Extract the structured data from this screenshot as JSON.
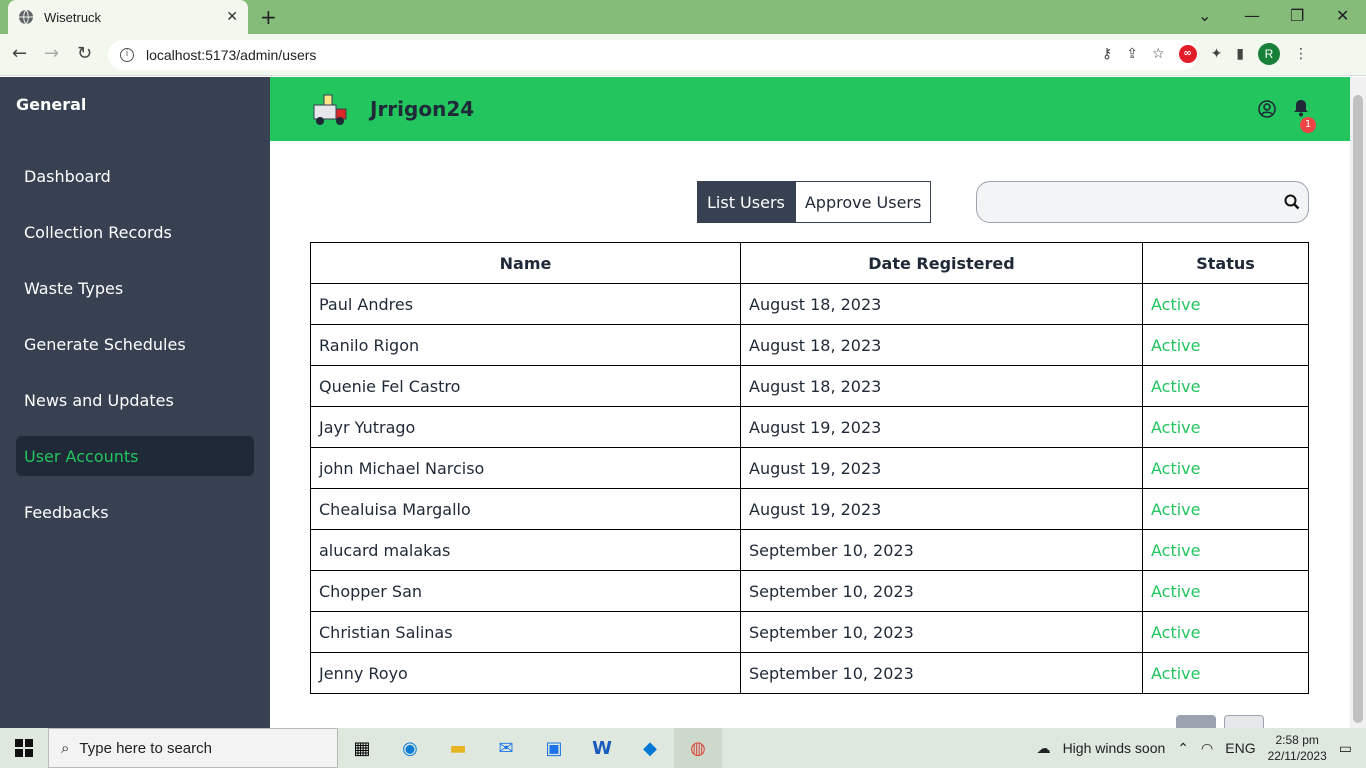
{
  "browser": {
    "tab_title": "Wisetruck",
    "url": "localhost:5173/admin/users",
    "profile_initial": "R"
  },
  "sidebar": {
    "heading": "General",
    "items": [
      {
        "label": "Dashboard"
      },
      {
        "label": "Collection Records"
      },
      {
        "label": "Waste Types"
      },
      {
        "label": "Generate Schedules"
      },
      {
        "label": "News and Updates"
      },
      {
        "label": "User Accounts"
      },
      {
        "label": "Feedbacks"
      }
    ],
    "active_item": "User Accounts"
  },
  "header": {
    "brand": "Jrrigon24",
    "notification_count": "1"
  },
  "tabs": {
    "list_users": "List Users",
    "approve_users": "Approve Users"
  },
  "search": {
    "value": ""
  },
  "table": {
    "columns": [
      "Name",
      "Date Registered",
      "Status"
    ],
    "rows": [
      {
        "name": "Paul Andres",
        "date": "August 18, 2023",
        "status": "Active"
      },
      {
        "name": "Ranilo Rigon",
        "date": "August 18, 2023",
        "status": "Active"
      },
      {
        "name": "Quenie Fel Castro",
        "date": "August 18, 2023",
        "status": "Active"
      },
      {
        "name": "Jayr Yutrago",
        "date": "August 19, 2023",
        "status": "Active"
      },
      {
        "name": "john Michael Narciso",
        "date": "August 19, 2023",
        "status": "Active"
      },
      {
        "name": "Chealuisa Margallo",
        "date": "August 19, 2023",
        "status": "Active"
      },
      {
        "name": "alucard malakas",
        "date": "September 10, 2023",
        "status": "Active"
      },
      {
        "name": "Chopper San",
        "date": "September 10, 2023",
        "status": "Active"
      },
      {
        "name": "Christian Salinas",
        "date": "September 10, 2023",
        "status": "Active"
      },
      {
        "name": "Jenny Royo",
        "date": "September 10, 2023",
        "status": "Active"
      }
    ]
  },
  "taskbar": {
    "search_placeholder": "Type here to search",
    "weather": "High winds soon",
    "language": "ENG",
    "time": "2:58 pm",
    "date": "22/11/2023"
  },
  "colors": {
    "accent_green": "#22c55e",
    "sidebar_bg": "#374151",
    "active_status": "#22c55e"
  }
}
